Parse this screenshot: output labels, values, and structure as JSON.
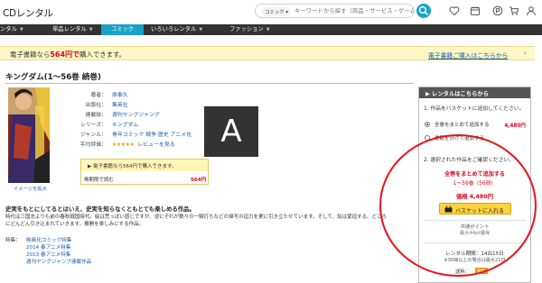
{
  "header": {
    "logo": "CDレンタル",
    "search_category": "コミック",
    "search_placeholder": "キーワードから探す（商品・サービス・ゲームなど）"
  },
  "nav": {
    "items": [
      "ンタル",
      "単品レンタル",
      "コミック",
      "いろいろレンタル",
      "ファッション"
    ],
    "active_index": 2
  },
  "notice": {
    "prefix": "電子書籍なら",
    "price": "564円で",
    "suffix": "購入できます。",
    "link": "電子書籍ご購入はこちらから"
  },
  "product": {
    "title": "キングダム(1〜56巻 続巻)",
    "cover_link": "イメージを拡大",
    "details": [
      {
        "label": "著者：",
        "value": "原泰久"
      },
      {
        "label": "出版社：",
        "value": "集英社"
      },
      {
        "label": "連載誌：",
        "value": "週刊ヤングジャンプ"
      },
      {
        "label": "シリーズ：",
        "value": "キングダム"
      },
      {
        "label": "ジャンル：",
        "value": "青年コミック 戦争 歴史 アニメ化"
      },
      {
        "label": "平均評価：",
        "value": ""
      }
    ],
    "rating_stars": "★★★★★",
    "rating": 4.5,
    "review_link": "レビューを見る"
  },
  "overlay_letter": "A",
  "ebook_box": {
    "header": "電子書籍なら564円で購入できます。",
    "free_label": "無期限で読む",
    "price": "564円"
  },
  "description": {
    "headline": "史実をもとにしてるとはいえ、史実を知らなくともとても楽しめる作品。",
    "lines": [
      "時代は三国志よりも前の春秋戦国時代。絵は荒っぽい感じですが、逆にそれが数々の一騎打ちなどの描写の迫力を更に引き立たせています。そして、話は緊迫する、どころ",
      "にどんどん引き込まれていきます。展開を楽しみにする作品。"
    ],
    "features_label": "特集：",
    "features": [
      "映画化コミック特集",
      "2014 春アニメ特集",
      "2013 春アニメ特集",
      "週刊ヤングジャンプ連載作品"
    ]
  },
  "rental_panel": {
    "header": "レンタルはこちらから",
    "step1": "1. 作品をバスケットに追加してください。",
    "options": [
      {
        "label": "全巻をまとめて追加する",
        "price": "4,480円",
        "selected": true
      },
      {
        "label": "巻数を分けて追加する",
        "price": "",
        "selected": false
      }
    ],
    "step2": "2. 選択された作品をご確認ください。",
    "selection": "全巻をまとめて追加する",
    "volumes": "1〜56巻（56冊）",
    "price": "価格 4,480円",
    "cart_button": "バスケットに入れる",
    "points_label": "共通ポイント",
    "points_value": "最大44pt獲得",
    "period": "レンタル期間：14泊15日",
    "note": "※30冊以上の場合は最大21日",
    "shipping_label": "送料：",
    "shipping_badge": "無料"
  },
  "colors": {
    "accent": "#19a2c6",
    "nav_bg": "#333333",
    "notice_bg": "#fff8c4",
    "price_red": "#e2001a",
    "link_blue": "#1a5ca8",
    "button_yellow": "#ffd23c",
    "annotation_red": "#e8141e"
  }
}
